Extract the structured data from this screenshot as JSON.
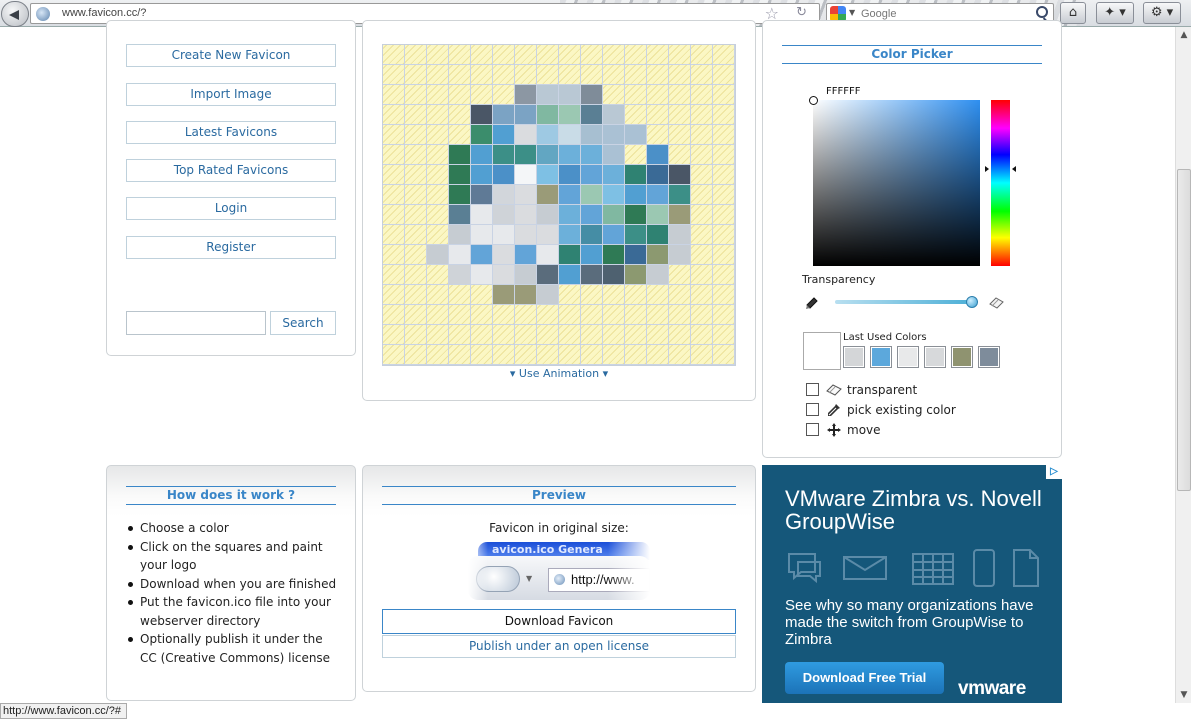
{
  "browser": {
    "url": "www.favicon.cc/?",
    "search_engine_label": "Google"
  },
  "status_bar": {
    "text": "http://www.favicon.cc/?#"
  },
  "sidebar": {
    "buttons": [
      {
        "label": "Create New Favicon"
      },
      {
        "label": "Import Image"
      },
      {
        "label": "Latest Favicons"
      },
      {
        "label": "Top Rated Favicons"
      },
      {
        "label": "Login"
      },
      {
        "label": "Register"
      }
    ],
    "search": {
      "value": "",
      "button_label": "Search"
    }
  },
  "editor": {
    "grid_size": 16,
    "pixels": [
      "tttttttttttttttt",
      "tttttttttttttttt",
      "tttttt9JJ0tttttt",
      "tttt1226G3Jttttt",
      "tttt8CYIV4AAtttt",
      "ttt5C77bOOAtNttt",
      "ttt5CNLBNEOHD1tt",
      "ttt5KSYPEGBCE7tt",
      "ttt3UWYgOE65GPtt",
      "tttgUUYYOQE7Hgtt",
      "ttgUEYEUHC5DXgtt",
      "tttWUYgaCaMXgttt",
      "tttttPPgtttttttt",
      "tttttttttttttttt",
      "tttttttttttttttt",
      "tttttttttttttttt"
    ],
    "palette": {
      "0": "#7f8c99",
      "1": "#4a5666",
      "2": "#7ba3c4",
      "3": "#5a7f94",
      "4": "#a7bfd1",
      "5": "#2f7a55",
      "6": "#80b8a1",
      "7": "#3c8f87",
      "8": "#3b8d6c",
      "9": "#8c97a3",
      "A": "#aac1d4",
      "B": "#7ec0e4",
      "C": "#519fd2",
      "D": "#3a6a96",
      "E": "#62a4d8",
      "G": "#9bc8b2",
      "H": "#2f8272",
      "I": "#9ec9e3",
      "J": "#b9c8d4",
      "K": "#5f7a96",
      "L": "#f4f6f8",
      "M": "#4e6170",
      "N": "#4b90c8",
      "O": "#6cb0da",
      "P": "#9a9b78",
      "Q": "#458da5",
      "S": "#d2d6db",
      "U": "#e7e9ec",
      "V": "#c9dce7",
      "W": "#cfd3d8",
      "X": "#8c9970",
      "Y": "#dadcdf",
      "a": "#5a6c7c",
      "b": "#62a6c2",
      "g": "#c6ccd2"
    },
    "use_animation_label": "Use Animation"
  },
  "color_picker": {
    "title": "Color Picker",
    "hex_value": "FFFFFF",
    "transparency_label": "Transparency",
    "transparency_level": 0.98,
    "last_used_label": "Last Used Colors",
    "last_used_colors": [
      "#d4d6d8",
      "#5ca8dc",
      "#e8e9ea",
      "#d7d9db",
      "#8f9370",
      "#7e8c9b"
    ],
    "options": [
      {
        "label": "transparent",
        "icon": "eraser-icon"
      },
      {
        "label": "pick existing color",
        "icon": "eyedropper-icon"
      },
      {
        "label": "move",
        "icon": "move-icon"
      }
    ]
  },
  "how_it_works": {
    "title": "How does it work ?",
    "steps": [
      "Choose a color",
      "Click on the squares and paint your logo",
      "Download when you are finished",
      "Put the favicon.ico file into your webserver directory",
      "Optionally publish it under the CC (Creative Commons) license"
    ]
  },
  "preview": {
    "title": "Preview",
    "original_size_label": "Favicon in original size:",
    "tab_text": "avicon.ico Genera",
    "url_text": "http://www.",
    "download_label": "Download Favicon",
    "publish_label": "Publish under an open license"
  },
  "ad": {
    "headline": "VMware Zimbra vs. Novell GroupWise",
    "body": "See why so many organizations have made the switch from GroupWise to Zimbra",
    "button_label": "Download Free Trial",
    "logo_text": "vmware"
  }
}
